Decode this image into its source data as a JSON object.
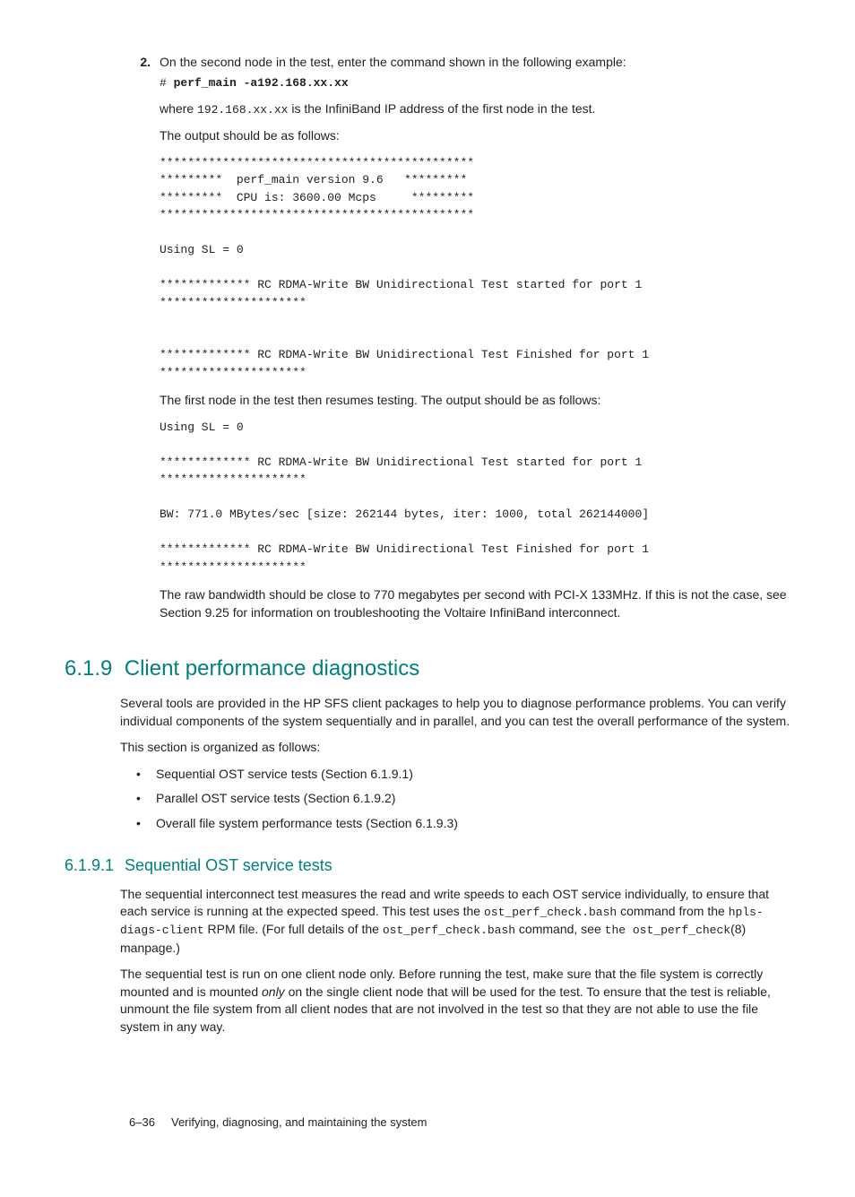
{
  "step": {
    "num": "2.",
    "intro": "On the second node in the test, enter the command shown in the following example:",
    "cmd_prefix": "# ",
    "cmd": "perf_main -a192.168.xx.xx",
    "where_a": "where ",
    "where_ip": "192.168.xx.xx",
    "where_b": " is the InfiniBand IP address of the first node in the test.",
    "out_intro": "The output should be as follows:",
    "out1": "*********************************************\n*********  perf_main version 9.6   *********\n*********  CPU is: 3600.00 Mcps     *********\n*********************************************\n\nUsing SL = 0\n\n************* RC RDMA-Write BW Unidirectional Test started for port 1\n*********************\n\n\n************* RC RDMA-Write BW Unidirectional Test Finished for port 1\n*********************",
    "resume": "The first node in the test then resumes testing. The output should be as follows:",
    "out2": "Using SL = 0\n\n************* RC RDMA-Write BW Unidirectional Test started for port 1\n*********************\n\nBW: 771.0 MBytes/sec [size: 262144 bytes, iter: 1000, total 262144000]\n\n************* RC RDMA-Write BW Unidirectional Test Finished for port 1\n*********************",
    "summary": "The raw bandwidth should be close to 770 megabytes per second with PCI-X 133MHz. If this is not the case, see Section 9.25 for information on troubleshooting the Voltaire InfiniBand interconnect."
  },
  "h619": {
    "num": "6.1.9",
    "title": "Client performance diagnostics",
    "p1": "Several tools are provided in the HP SFS client packages to help you to diagnose performance problems. You can verify individual components of the system sequentially and in parallel, and you can test the overall performance of the system.",
    "p2": "This section is organized as follows:",
    "bullets": [
      "Sequential OST service tests (Section 6.1.9.1)",
      "Parallel OST service tests (Section 6.1.9.2)",
      "Overall file system performance tests (Section 6.1.9.3)"
    ]
  },
  "h6191": {
    "num": "6.1.9.1",
    "title": "Sequential OST service tests",
    "p1a": "The sequential interconnect test measures the read and write speeds to each OST service individually, to ensure that each service is running at the expected speed. This test uses the ",
    "p1b": "ost_perf_check.bash",
    "p1c": " command from the ",
    "p1d": "hpls-diags-client",
    "p1e": " RPM file. (For full details of the ",
    "p1f": "ost_perf_check.bash",
    "p1g": " command, see ",
    "p1h": "the ost_perf_check",
    "p1i": "(8) manpage.)",
    "p2a": "The sequential test is run on one client node only. Before running the test, make sure that the file system is correctly mounted and is mounted ",
    "p2b": "only",
    "p2c": " on the single client node that will be used for the test. To ensure that the test is reliable, unmount the file system from all client nodes that are not involved in the test so that they are not able to use the file system in any way."
  },
  "footer": {
    "page": "6–36",
    "title": "Verifying, diagnosing, and maintaining the system"
  }
}
